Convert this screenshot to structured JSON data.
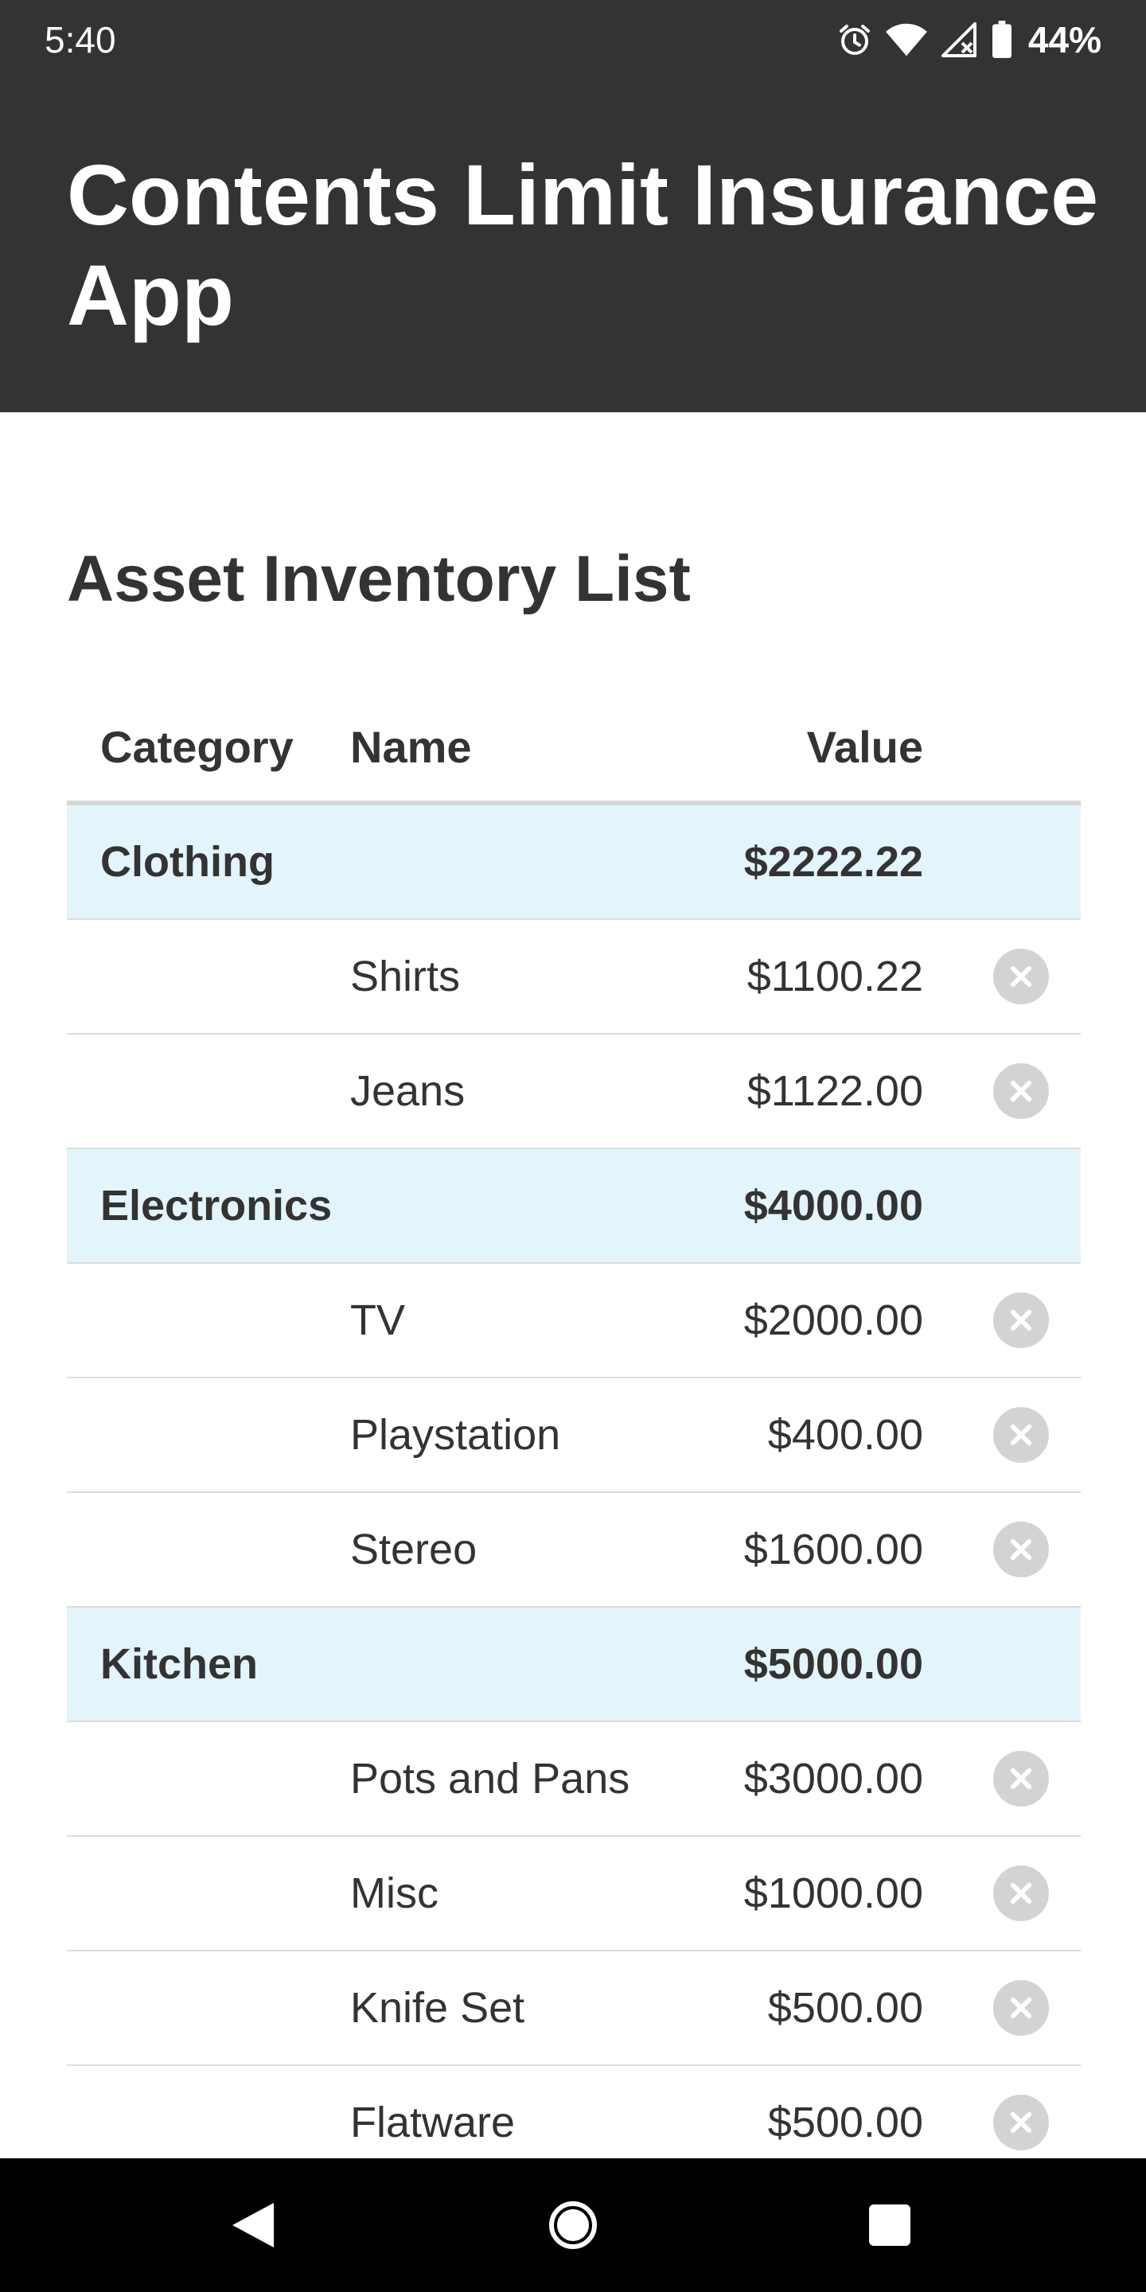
{
  "status_bar": {
    "time": "5:40",
    "battery": "44%",
    "icons": [
      "alarm-icon",
      "wifi-icon",
      "cell-signal-icon",
      "battery-icon"
    ]
  },
  "header": {
    "title": "Contents Limit Insurance App",
    "background": "#333333"
  },
  "main": {
    "section_title": "Asset Inventory List",
    "columns": {
      "category": "Category",
      "name": "Name",
      "value": "Value"
    },
    "category_row_color": "#e3f4fa",
    "rows": [
      {
        "type": "category",
        "category": "Clothing",
        "value": "$2222.22"
      },
      {
        "type": "item",
        "name": "Shirts",
        "value": "$1100.22"
      },
      {
        "type": "item",
        "name": "Jeans",
        "value": "$1122.00"
      },
      {
        "type": "category",
        "category": "Electronics",
        "value": "$4000.00"
      },
      {
        "type": "item",
        "name": "TV",
        "value": "$2000.00"
      },
      {
        "type": "item",
        "name": "Playstation",
        "value": "$400.00"
      },
      {
        "type": "item",
        "name": "Stereo",
        "value": "$1600.00"
      },
      {
        "type": "category",
        "category": "Kitchen",
        "value": "$5000.00"
      },
      {
        "type": "item",
        "name": "Pots and Pans",
        "value": "$3000.00"
      },
      {
        "type": "item",
        "name": "Misc",
        "value": "$1000.00"
      },
      {
        "type": "item",
        "name": "Knife Set",
        "value": "$500.00"
      },
      {
        "type": "item",
        "name": "Flatware",
        "value": "$500.00"
      }
    ],
    "delete_icon": "close-circle-icon"
  },
  "nav_bar": {
    "buttons": [
      "back-icon",
      "home-icon",
      "recents-icon"
    ]
  }
}
